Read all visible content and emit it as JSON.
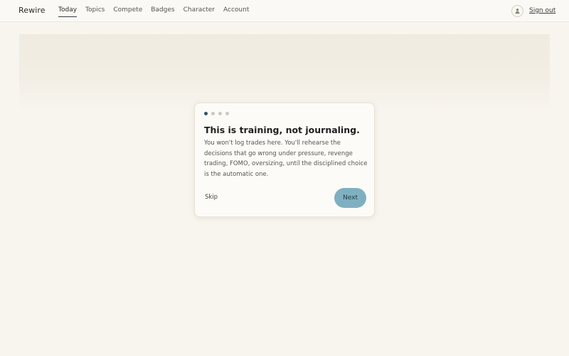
{
  "app": {
    "brand": "Rewire"
  },
  "nav": {
    "items": [
      {
        "label": "Today",
        "active": true
      },
      {
        "label": "Topics"
      },
      {
        "label": "Compete"
      },
      {
        "label": "Badges"
      },
      {
        "label": "Character"
      },
      {
        "label": "Account"
      }
    ]
  },
  "header": {
    "avatar_icon": "user-icon",
    "signout_label": "Sign out"
  },
  "onboarding": {
    "step_current": 1,
    "step_total": 4,
    "title": "This is training, not journaling.",
    "body": "You won't log trades here. You'll rehearse the decisions that go wrong under pressure, revenge trading, FOMO, oversizing, until the disciplined choice is the automatic one.",
    "skip_label": "Skip",
    "next_label": "Next"
  },
  "colors": {
    "background": "#f8f5ef",
    "accent_button": "#7fb0c1",
    "active_dot": "#2f5568",
    "inactive_dot": "#cfc9bd"
  }
}
